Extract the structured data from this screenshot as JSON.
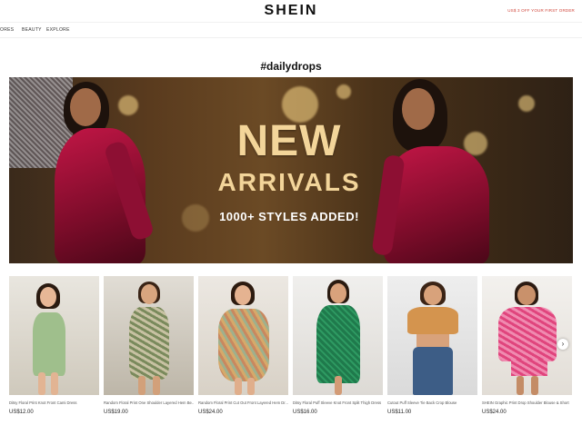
{
  "header": {
    "logo": "SHEIN",
    "promo": "US$ 3 OFF YOUR FIRST ORDER"
  },
  "nav": {
    "items": [
      "ORES",
      "BEAUTY",
      "EXPLORE"
    ]
  },
  "section": {
    "title": "#dailydrops"
  },
  "banner": {
    "headline": "NEW",
    "subheadline": "ARRIVALS",
    "note": "1000+ STYLES ADDED!"
  },
  "products": [
    {
      "name": "Ditsy Floral Print Knot Front Cami Dress",
      "price": "US$12.00"
    },
    {
      "name": "Random Floral Print One Shoulder Layered Hem Be...",
      "price": "US$19.00"
    },
    {
      "name": "Random Floral Print Cut Out Front Layered Hem Dr...",
      "price": "US$24.00"
    },
    {
      "name": "Ditsy Floral Puff Sleeve Knot Front Split Thigh Dress",
      "price": "US$16.00"
    },
    {
      "name": "Cutout Puff Sleeve Tie Back Crop Blouse",
      "price": "US$11.00"
    },
    {
      "name": "SHEIN Graphic Print Drop Shoulder Blouse & Short",
      "price": "US$24.00"
    }
  ],
  "icons": {
    "next": "chevron-right-icon"
  },
  "colors": {
    "promo": "#d0453a",
    "banner_text": "#f3d59a",
    "velvet": "#c21646"
  }
}
